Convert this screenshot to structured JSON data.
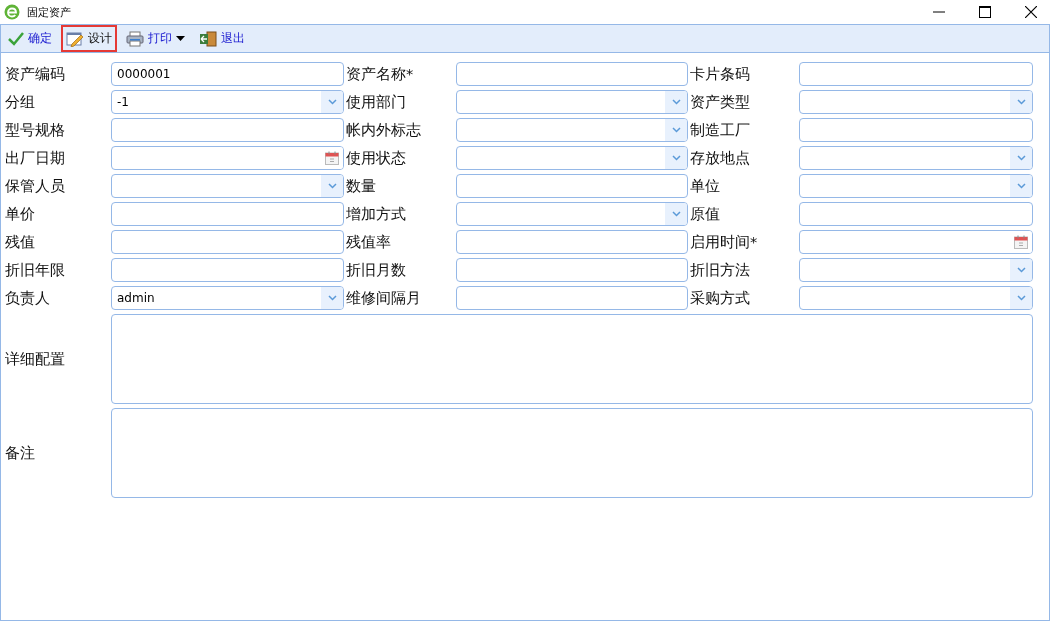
{
  "window": {
    "title": "固定资产"
  },
  "toolbar": [
    {
      "label": "确定",
      "kind": "ok",
      "selected": false
    },
    {
      "label": "设计",
      "kind": "design",
      "selected": true
    },
    {
      "label": "打印",
      "kind": "print",
      "selected": false
    },
    {
      "label": "退出",
      "kind": "exit",
      "selected": false
    }
  ],
  "fields": [
    {
      "label": "资产编码",
      "kind": "text",
      "value": "0000001"
    },
    {
      "label": "资产名称*",
      "kind": "text"
    },
    {
      "label": "卡片条码",
      "kind": "text"
    },
    {
      "label": "分组",
      "kind": "combo",
      "value": "-1"
    },
    {
      "label": "使用部门",
      "kind": "combo"
    },
    {
      "label": "资产类型",
      "kind": "combo"
    },
    {
      "label": "型号规格",
      "kind": "text"
    },
    {
      "label": "帐内外标志",
      "kind": "combo"
    },
    {
      "label": "制造工厂",
      "kind": "text"
    },
    {
      "label": "出厂日期",
      "kind": "date"
    },
    {
      "label": "使用状态",
      "kind": "combo"
    },
    {
      "label": "存放地点",
      "kind": "combo"
    },
    {
      "label": "保管人员",
      "kind": "combo"
    },
    {
      "label": "数量",
      "kind": "text"
    },
    {
      "label": "单位",
      "kind": "combo"
    },
    {
      "label": "单价",
      "kind": "text"
    },
    {
      "label": "增加方式",
      "kind": "combo"
    },
    {
      "label": "原值",
      "kind": "text"
    },
    {
      "label": "残值",
      "kind": "text"
    },
    {
      "label": "残值率",
      "kind": "text"
    },
    {
      "label": "启用时间*",
      "kind": "date"
    },
    {
      "label": "折旧年限",
      "kind": "text"
    },
    {
      "label": "折旧月数",
      "kind": "text"
    },
    {
      "label": "折旧方法",
      "kind": "combo"
    },
    {
      "label": "负责人",
      "kind": "combo",
      "value": "admin"
    },
    {
      "label": "维修间隔月",
      "kind": "text"
    },
    {
      "label": "采购方式",
      "kind": "combo"
    }
  ],
  "textareas": [
    {
      "label": "详细配置"
    },
    {
      "label": "备注"
    }
  ]
}
